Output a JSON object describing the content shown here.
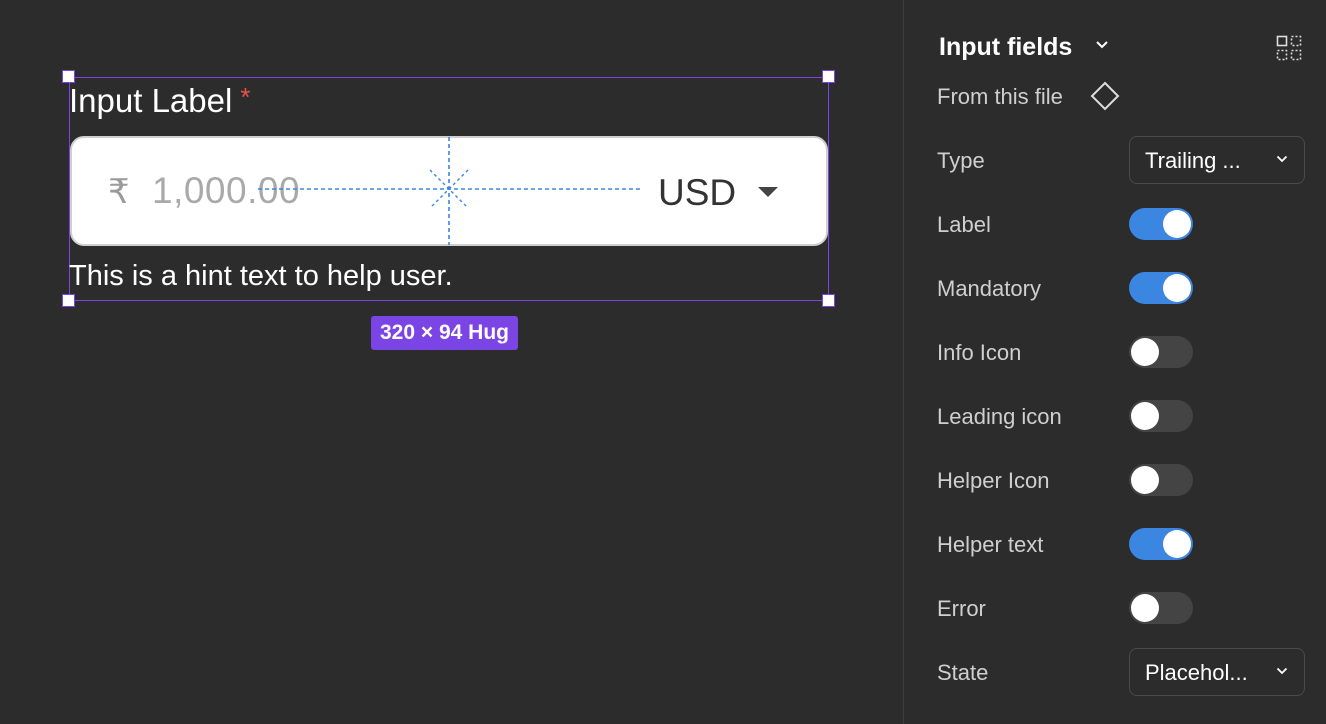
{
  "canvas": {
    "component": {
      "label": "Input Label",
      "required_mark": "*",
      "currency_symbol": "₹",
      "amount_placeholder": "1,000.00",
      "currency_code": "USD",
      "hint": "This is a hint text to help user."
    },
    "selection_size": "320 × 94 Hug"
  },
  "panel": {
    "title": "Input fields",
    "source": "From this file",
    "type": {
      "label": "Type",
      "value": "Trailing ..."
    },
    "toggles": [
      {
        "label": "Label",
        "on": true
      },
      {
        "label": "Mandatory",
        "on": true
      },
      {
        "label": "Info Icon",
        "on": false
      },
      {
        "label": "Leading icon",
        "on": false
      },
      {
        "label": "Helper Icon",
        "on": false
      },
      {
        "label": "Helper text",
        "on": true
      },
      {
        "label": "Error",
        "on": false
      }
    ],
    "state": {
      "label": "State",
      "value": "Placehol..."
    }
  },
  "colors": {
    "accent_selection": "#7b45e6",
    "toggle_on": "#3a86e0",
    "required": "#e5534b"
  }
}
